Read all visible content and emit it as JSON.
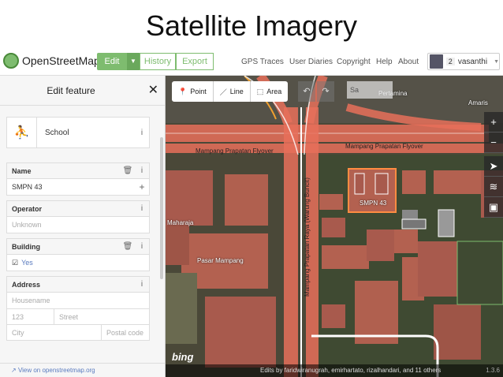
{
  "slide": {
    "title": "Satellite Imagery"
  },
  "header": {
    "logo_text": "OpenStreetMap",
    "edit_label": "Edit",
    "history_label": "History",
    "export_label": "Export",
    "nav": [
      "GPS Traces",
      "User Diaries",
      "Copyright",
      "Help",
      "About"
    ],
    "user": {
      "count": "2",
      "name": "vasanthi"
    }
  },
  "sidebar": {
    "title": "Edit feature",
    "preset_name": "School",
    "fields": {
      "name": {
        "label": "Name",
        "value": "SMPN 43"
      },
      "operator": {
        "label": "Operator",
        "placeholder": "Unknown"
      },
      "building": {
        "label": "Building",
        "value": "Yes"
      },
      "address": {
        "label": "Address",
        "housename": "Housename",
        "housenumber": "123",
        "street": "Street",
        "city": "City",
        "postcode": "Postal code"
      }
    },
    "footer_link": "View on openstreetmap.org"
  },
  "map": {
    "tools": [
      "Point",
      "Line",
      "Area"
    ],
    "search_text": "Sa",
    "labels": {
      "flyover1": "Mampang Prapatan Flyover",
      "flyover2": "Mampang Prapatan Flyover",
      "raya": "Mampang Prapatan Raya (Warung Buncit)",
      "school": "SMPN 43",
      "maharaja": "Maharaja",
      "pasar": "Pasar Mampang",
      "pertamina": "Pertamina",
      "amaris": "Amaris"
    },
    "bing": "bing",
    "attribution": "Edits by faridwiranugrah, emirhartato, rizalhandari, and 11 others",
    "version": "1.3.6"
  },
  "colors": {
    "accent": "#7ebc6f",
    "road": "#e8705a",
    "building": "#c0665a"
  }
}
